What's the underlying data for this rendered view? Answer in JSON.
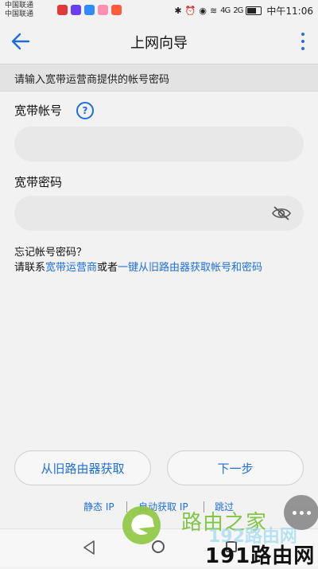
{
  "status_bar": {
    "carrier_1": "中国联通",
    "carrier_2": "中国联通",
    "network_4g": "4G",
    "network_2g": "2G",
    "time": "中午11:06",
    "app_colors": [
      "#e4393c",
      "#6a3ff0",
      "#2f8bff",
      "#ff8fb1",
      "#ff5a3c"
    ]
  },
  "app_bar": {
    "title": "上网向导",
    "back_icon": "arrow-left-icon",
    "more_icon": "more-vertical-icon",
    "accent": "#1e6fd9"
  },
  "banner": {
    "text": "请输入宽带运营商提供的帐号密码"
  },
  "form": {
    "account_label": "宽带帐号",
    "account_value": "",
    "help_icon_glyph": "?",
    "password_label": "宽带密码",
    "password_value": ""
  },
  "hint": {
    "line1": "忘记帐号密码？",
    "line2_prefix": "请联系",
    "isp_link": "宽带运营商",
    "or_text": "或者",
    "oneclick_link": "一键从旧路由器获取帐号和密码"
  },
  "buttons": {
    "get_from_old": "从旧路由器获取",
    "next": "下一步"
  },
  "bottom_links": {
    "static_ip": "静态 IP",
    "auto_ip": "自动获取 IP",
    "skip": "跳过"
  },
  "watermark": {
    "text1": "路由之家",
    "text2": "192路由网",
    "text3": "191路由网"
  }
}
